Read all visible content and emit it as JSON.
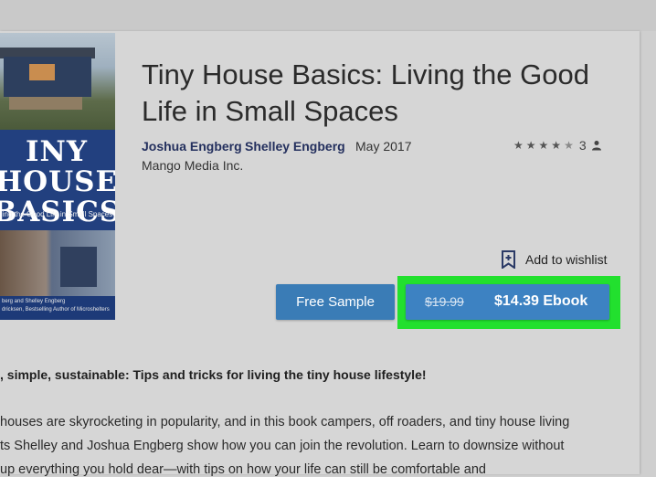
{
  "book": {
    "title": "Tiny House Basics: Living the Good Life in Small Spaces",
    "authors": [
      "Joshua Engberg",
      "Shelley Engberg"
    ],
    "date": "May 2017",
    "publisher": "Mango Media Inc.",
    "rating_count": "3",
    "stars": 4.5
  },
  "cover": {
    "title": "INY HOUSE BASICS",
    "tagline": "ing the Good Life in Small Spaces",
    "credit_line1": "berg and Shelley Engberg",
    "credit_line2": "dricksen, Bestselling Author of Microshelters"
  },
  "actions": {
    "wishlist_label": "Add to wishlist",
    "sample_label": "Free Sample",
    "old_price": "$19.99",
    "buy_label": "$14.39 Ebook"
  },
  "description": {
    "headline": ", simple, sustainable: Tips and tricks for living the tiny house lifestyle!",
    "lines": [
      "houses are skyrocketing in popularity, and in this book campers, off roaders, and tiny house living",
      "ts Shelley and Joshua Engberg show how you can join the revolution. Learn to downsize without",
      " up everything you hold dear—with tips on how your life can still be comfortable and"
    ]
  },
  "colors": {
    "button_blue": "#3d82c2",
    "highlight_green": "#22e02e",
    "author_link": "#24305e"
  },
  "icons": {
    "wishlist": "bookmark-plus-icon",
    "reviewer": "person-icon",
    "rating": "star-icon"
  }
}
